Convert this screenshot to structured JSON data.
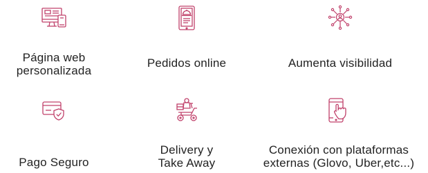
{
  "accent_color": "#c0406a",
  "features": [
    {
      "label": "Página web\npersonalizada",
      "icon": "website-devices-icon"
    },
    {
      "label": "Pedidos online",
      "icon": "tablet-food-icon"
    },
    {
      "label": "Aumenta visibilidad",
      "icon": "network-user-icon"
    },
    {
      "label": "Pago Seguro",
      "icon": "secure-card-icon"
    },
    {
      "label": "Delivery y\nTake Away",
      "icon": "delivery-scooter-icon"
    },
    {
      "label": "Conexión con plataformas\nexternas (Glovo, Uber,etc...)",
      "icon": "phone-touch-icon"
    }
  ]
}
